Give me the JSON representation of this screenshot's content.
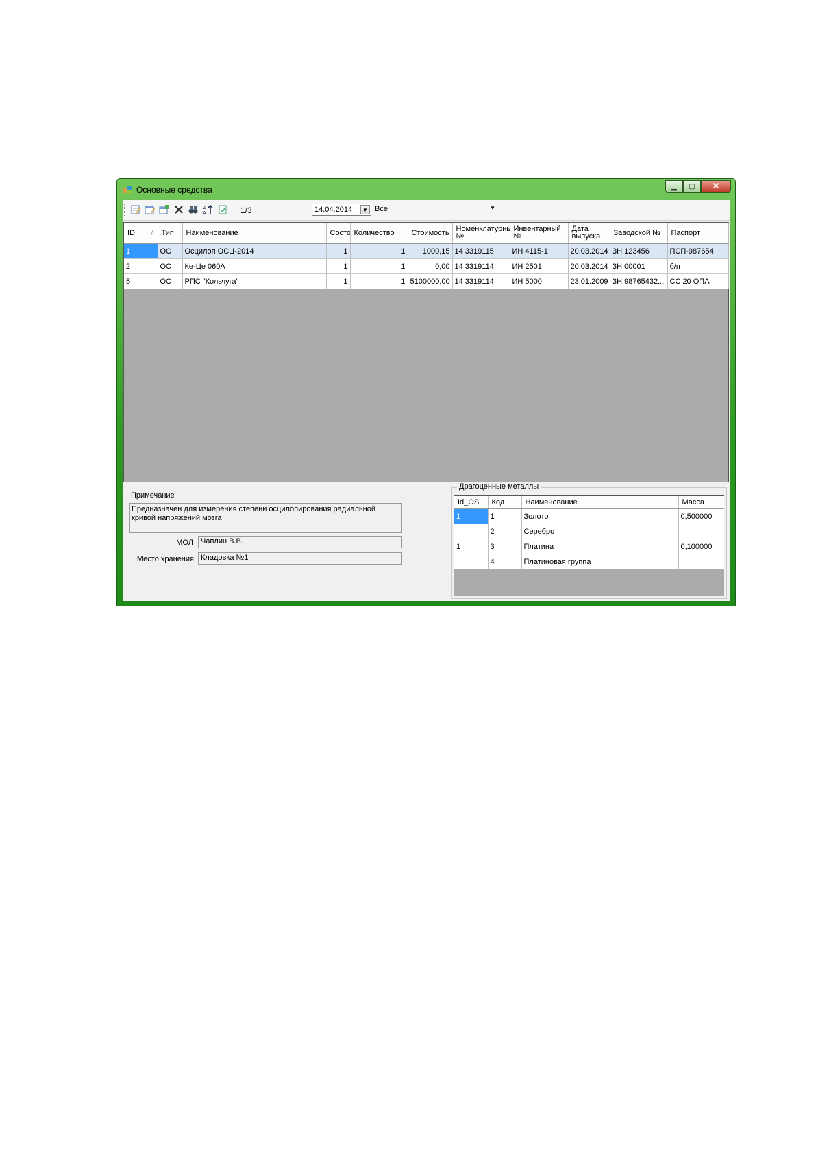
{
  "window": {
    "title": "Основные средства",
    "min_glyph": "▁",
    "max_glyph": "▢",
    "close_glyph": "✕"
  },
  "toolbar": {
    "icons": [
      "edit-icon",
      "add-icon",
      "copy-icon",
      "delete-icon",
      "find-icon",
      "sort-icon",
      "export-icon"
    ],
    "pager": "1/3",
    "date": "14.04.2014",
    "filter": "Все",
    "dropdown_glyph": "▼"
  },
  "main_table": {
    "columns": [
      "ID",
      "Тип",
      "Наименование",
      "Состо",
      "Количество",
      "Стоимость",
      "Номенклатурный №",
      "Инвентарный №",
      "Дата выпуска",
      "Заводской №",
      "Паспорт"
    ],
    "rows": [
      [
        "1",
        "ОС",
        "Осцилоп ОСЦ-2014",
        "1",
        "1",
        "1000,15",
        "14 3319115",
        "ИН 4115-1",
        "20.03.2014",
        "ЗН 123456",
        "ПСП-987654"
      ],
      [
        "2",
        "ОС",
        "Ке-Це 060А",
        "1",
        "1",
        "0,00",
        "14 3319114",
        "ИН 2501",
        "20.03.2014",
        "ЗН 00001",
        "б/п"
      ],
      [
        "5",
        "ОС",
        "РПС \"Кольчуга\"",
        "1",
        "1",
        "5100000,00",
        "14 3319114",
        "ИН 5000",
        "23.01.2009",
        "ЗН 98765432...",
        "СС 20 ОПА"
      ]
    ]
  },
  "notes": {
    "label": "Примечание",
    "text": "Предназначен для измерения степени осцилопирования радиальной кривой напряжений мозга",
    "mol_label": "МОЛ",
    "mol_value": "Чаплин В.В.",
    "storage_label": "Место хранения",
    "storage_value": "Кладовка №1"
  },
  "metals": {
    "title": "Драгоценные металлы",
    "columns": [
      "Id_OS",
      "Код",
      "Наименование",
      "Масса"
    ],
    "rows": [
      [
        "1",
        "1",
        "Золото",
        "0,500000"
      ],
      [
        "",
        "2",
        "Серебро",
        ""
      ],
      [
        "1",
        "3",
        "Платина",
        "0,100000"
      ],
      [
        "",
        "4",
        "Платиновая группа",
        ""
      ]
    ]
  }
}
